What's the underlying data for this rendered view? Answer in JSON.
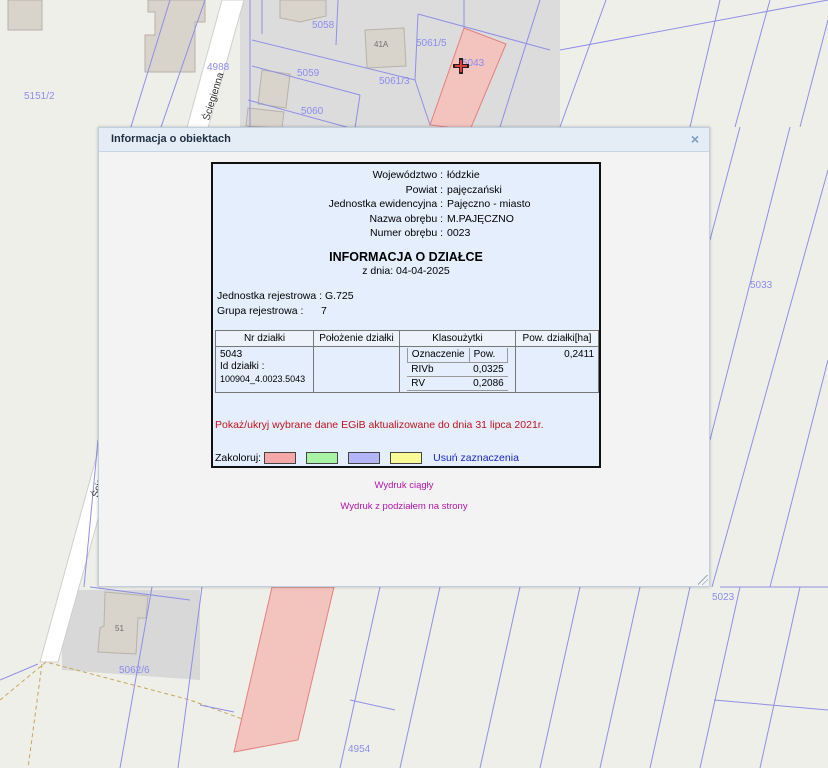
{
  "map": {
    "labels": [
      {
        "text": "5151/2"
      },
      {
        "text": "4988"
      },
      {
        "text": "Ściegienna"
      },
      {
        "text": "5058"
      },
      {
        "text": "41A"
      },
      {
        "text": "5061/5"
      },
      {
        "text": "5043"
      },
      {
        "text": "5059"
      },
      {
        "text": "5061/3"
      },
      {
        "text": "5060"
      },
      {
        "text": "5033"
      },
      {
        "text": "5023"
      },
      {
        "text": "51"
      },
      {
        "text": "5062/6"
      },
      {
        "text": "4954"
      },
      {
        "text": "Ście"
      }
    ],
    "colors": {
      "background": "#efefea",
      "parcel_line": "#8f8fe8",
      "building": "#dedcd6",
      "highlight_fill": "#f3c3be",
      "highlight_stroke": "#e57f7f"
    },
    "marker_icon": "crosshair-pin-icon"
  },
  "dialog": {
    "title": "Informacja o obiektach",
    "close_icon": "close-icon",
    "admin": {
      "voivodeship_label": "Województwo :",
      "voivodeship": "łódzkie",
      "county_label": "Powiat :",
      "county": "pajęczański",
      "unit_label": "Jednostka ewidencyjna :",
      "unit": "Pajęczno - miasto",
      "precinct_name_label": "Nazwa obrębu :",
      "precinct_name": "M.PAJĘCZNO",
      "precinct_number_label": "Numer obrębu :",
      "precinct_number": "0023"
    },
    "heading": "INFORMACJA O DZIAŁCE",
    "date_line": "z dnia: 04-04-2025",
    "registry": {
      "unit_label": "Jednostka rejestrowa :",
      "unit": "G.725",
      "group_label": "Grupa rejestrowa :",
      "group": "7"
    },
    "table": {
      "headers": [
        "Nr działki",
        "Położenie działki",
        "Klasoużytki",
        "Pow. działki[ha]"
      ],
      "parcel_number": "5043",
      "parcel_id_label": "Id działki :",
      "parcel_id": "100904_4.0023.5043",
      "location": "",
      "land_use_headers": [
        "Oznaczenie",
        "Pow."
      ],
      "land_use_rows": [
        {
          "code": "RIVb",
          "area": "0,0325"
        },
        {
          "code": "RV",
          "area": "0,2086"
        }
      ],
      "area_total": "0,2411"
    },
    "egib_link": "Pokaż/ukryj wybrane dane EGiB aktualizowane do dnia 31 lipca 2021r.",
    "colorize_label": "Zakoloruj:",
    "swatches": [
      {
        "name": "red",
        "color": "#f4a8a8"
      },
      {
        "name": "green",
        "color": "#a8f4a4"
      },
      {
        "name": "blue",
        "color": "#b4b4f8"
      },
      {
        "name": "yellow",
        "color": "#fafa96"
      }
    ],
    "clear_link": "Usuń zaznaczenia",
    "print_continuous": "Wydruk ciągły",
    "print_paged": "Wydruk z podziałem na strony"
  }
}
